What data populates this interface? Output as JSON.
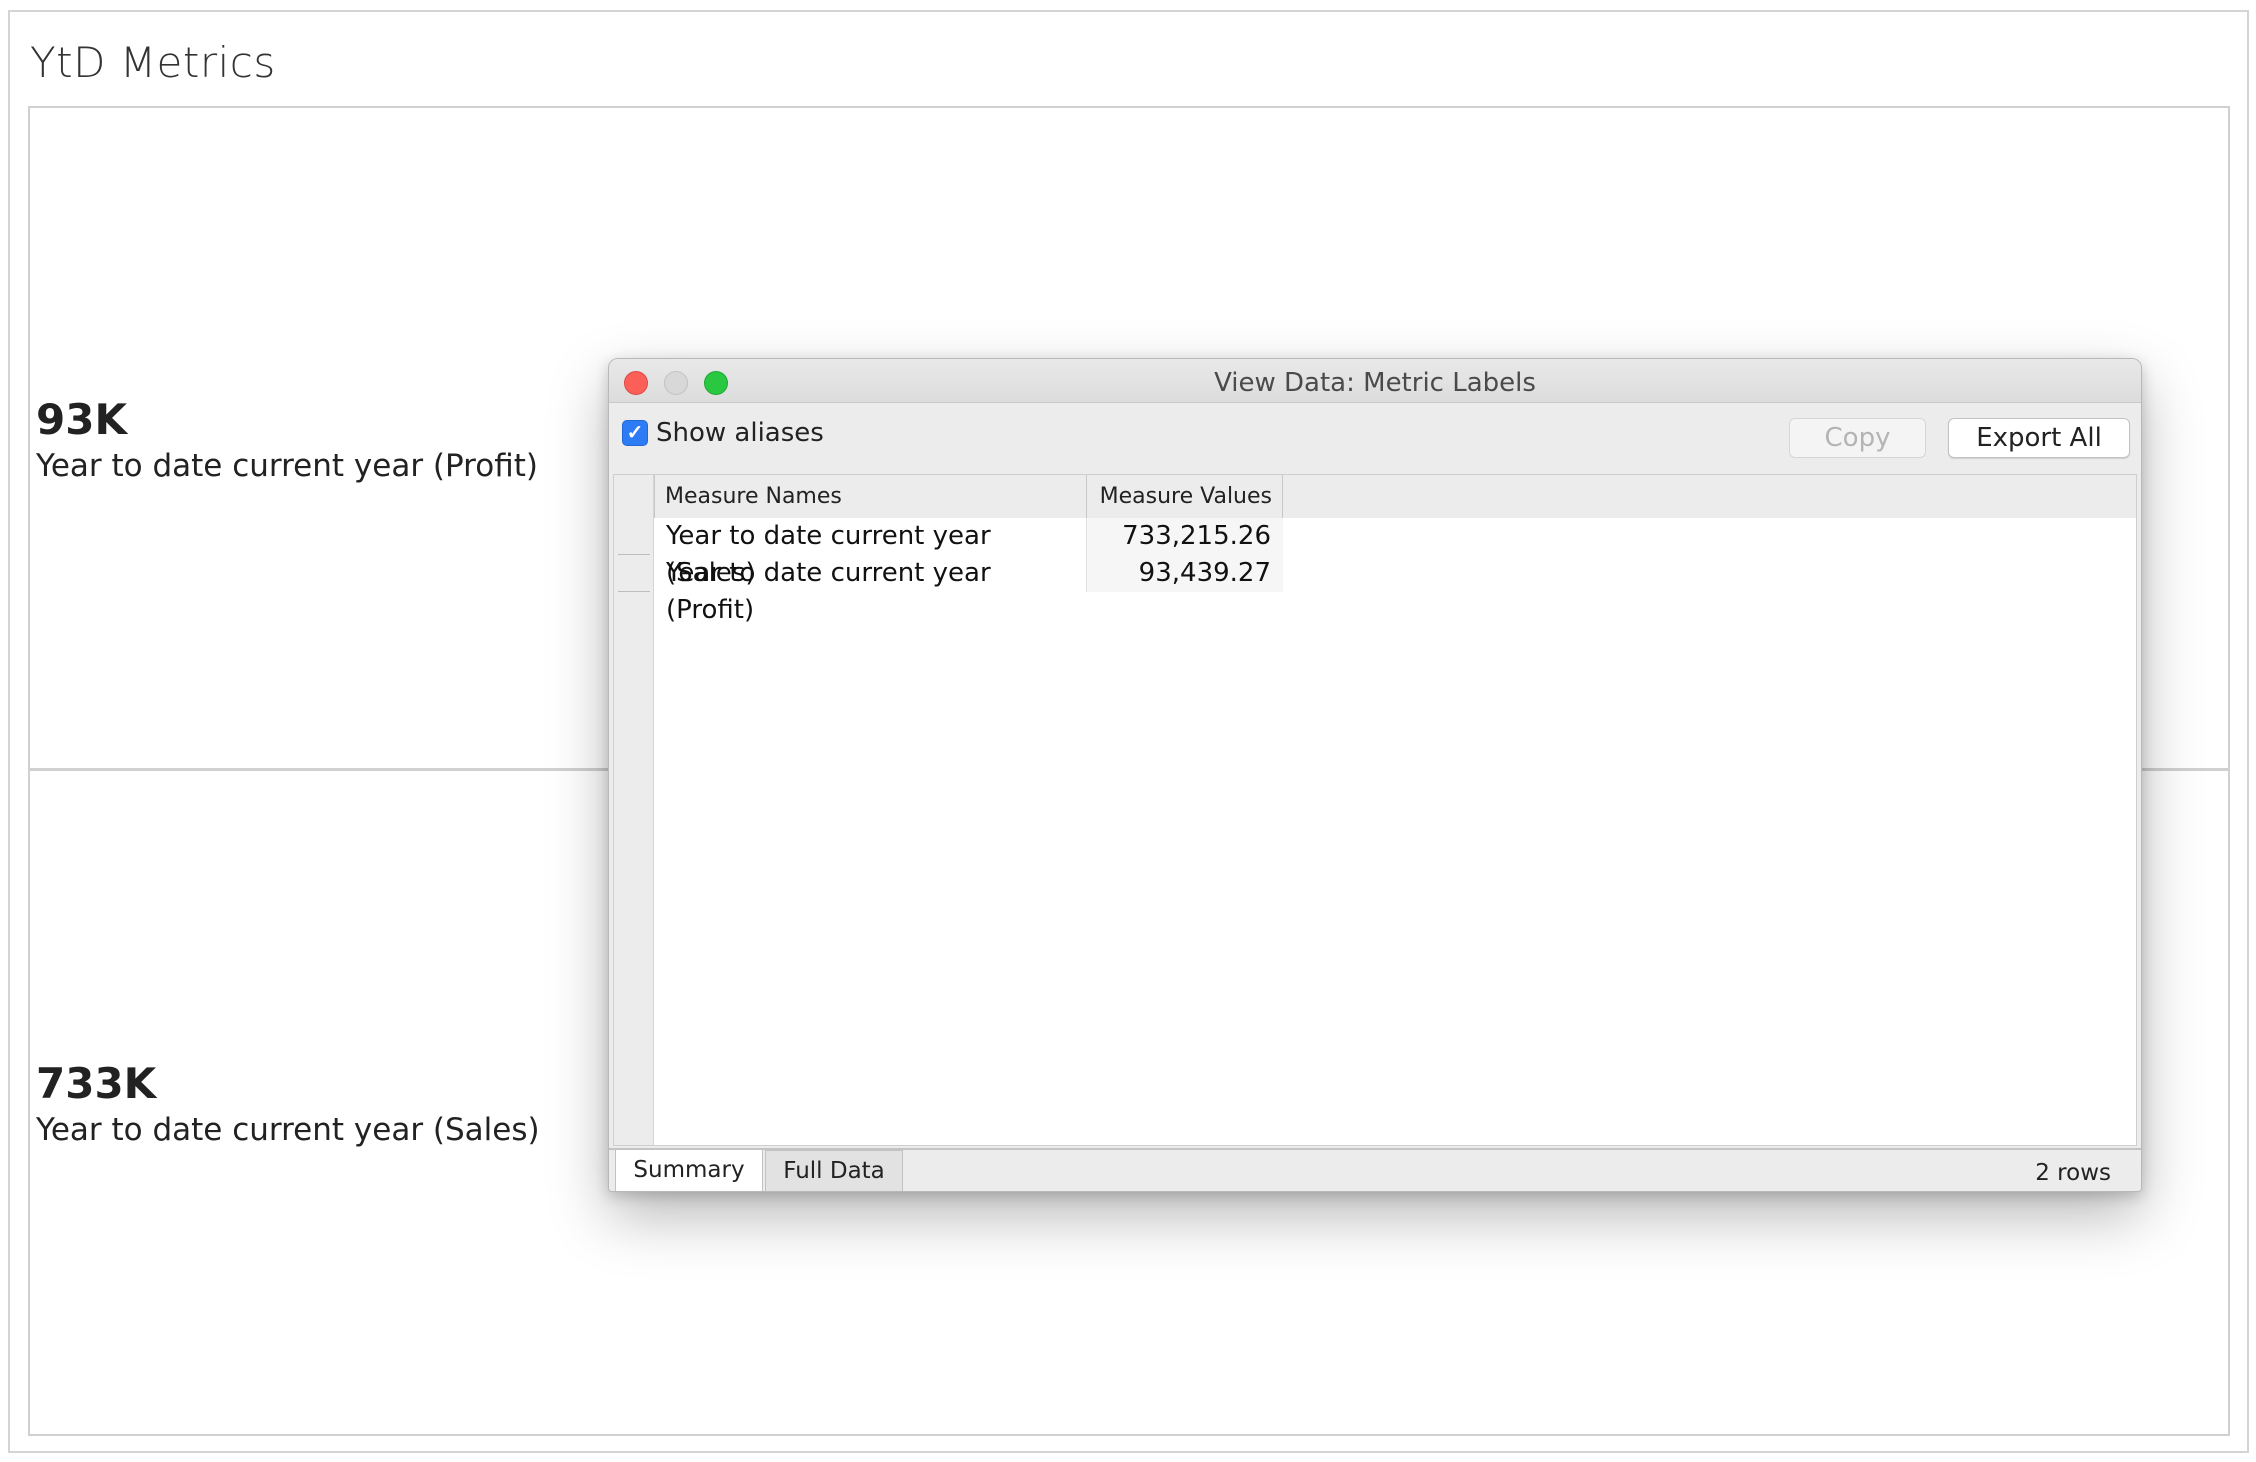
{
  "dashboard": {
    "title": "YtD Metrics",
    "metrics": [
      {
        "value": "93K",
        "label": "Year to date current year (Profit)"
      },
      {
        "value": "733K",
        "label": "Year to date current year (Sales)"
      }
    ]
  },
  "view_data_window": {
    "title": "View Data:  Metric Labels",
    "show_aliases": {
      "label": "Show aliases",
      "checked": true
    },
    "copy_label": "Copy",
    "export_all_label": "Export All",
    "table": {
      "columns": [
        "Measure Names",
        "Measure Values"
      ],
      "rows": [
        {
          "name": "Year to date current year (Sales)",
          "value": "733,215.26"
        },
        {
          "name": "Year to date current year (Profit)",
          "value": "93,439.27"
        }
      ]
    },
    "tabs": [
      "Summary",
      "Full Data"
    ],
    "active_tab": "Summary",
    "row_count": "2 rows"
  },
  "colors": {
    "checkbox_accent": "#2d7cf6",
    "close": "#fc5f57",
    "zoom": "#29c840"
  }
}
